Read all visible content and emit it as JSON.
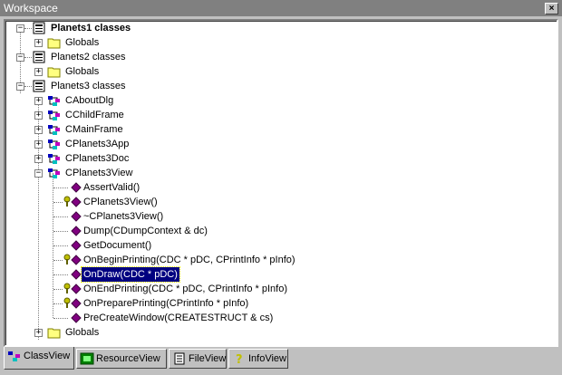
{
  "window": {
    "title": "Workspace"
  },
  "tree": {
    "nodes": [
      {
        "label": "Planets1 classes",
        "bold": true
      },
      {
        "label": "Globals"
      },
      {
        "label": "Planets2 classes"
      },
      {
        "label": "Globals"
      },
      {
        "label": "Planets3 classes"
      },
      {
        "label": "CAboutDlg"
      },
      {
        "label": "CChildFrame"
      },
      {
        "label": "CMainFrame"
      },
      {
        "label": "CPlanets3App"
      },
      {
        "label": "CPlanets3Doc"
      },
      {
        "label": "CPlanets3View"
      },
      {
        "label": "AssertValid()"
      },
      {
        "label": "CPlanets3View()"
      },
      {
        "label": "~CPlanets3View()"
      },
      {
        "label": "Dump(CDumpContext & dc)"
      },
      {
        "label": "GetDocument()"
      },
      {
        "label": "OnBeginPrinting(CDC * pDC, CPrintInfo * pInfo)"
      },
      {
        "label": "OnDraw(CDC * pDC)",
        "selected": true
      },
      {
        "label": "OnEndPrinting(CDC * pDC, CPrintInfo * pInfo)"
      },
      {
        "label": "OnPreparePrinting(CPrintInfo * pInfo)"
      },
      {
        "label": "PreCreateWindow(CREATESTRUCT & cs)"
      },
      {
        "label": "Globals"
      }
    ]
  },
  "tabs": [
    {
      "label": "ClassView",
      "active": true
    },
    {
      "label": "ResourceView"
    },
    {
      "label": "FileView"
    },
    {
      "label": "InfoView"
    }
  ],
  "colors": {
    "selection": "#000080",
    "method": "#800080",
    "folder": "#ffff80",
    "key": "#c0c000"
  }
}
